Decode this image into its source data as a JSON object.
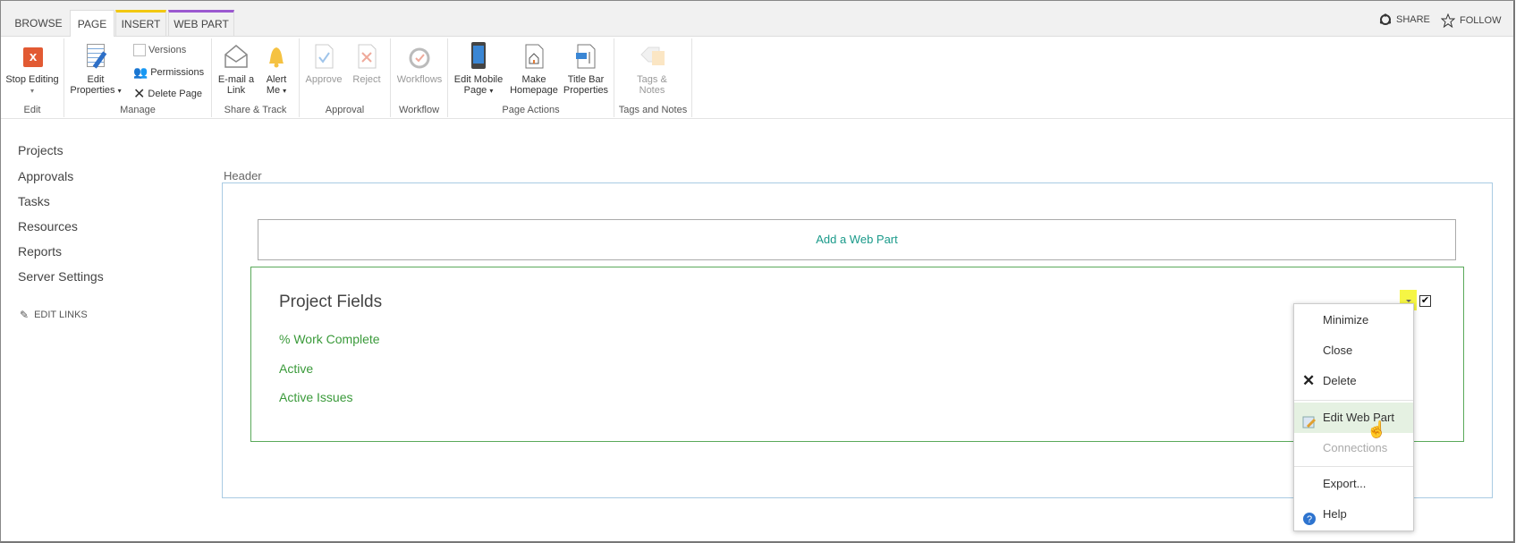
{
  "tabs": {
    "browse": "BROWSE",
    "page": "PAGE",
    "insert": "INSERT",
    "webpart": "WEB PART"
  },
  "top_actions": {
    "share": "SHARE",
    "follow": "FOLLOW"
  },
  "ribbon": {
    "edit": {
      "label": "Edit",
      "stop_editing": "Stop Editing"
    },
    "manage": {
      "label": "Manage",
      "edit_properties_1": "Edit",
      "edit_properties_2": "Properties",
      "versions": "Versions",
      "permissions": "Permissions",
      "delete_page": "Delete Page"
    },
    "share": {
      "label": "Share & Track",
      "email_1": "E-mail a",
      "email_2": "Link",
      "alert_1": "Alert",
      "alert_2": "Me"
    },
    "approval": {
      "label": "Approval",
      "approve": "Approve",
      "reject": "Reject"
    },
    "workflow": {
      "label": "Workflow",
      "workflows": "Workflows"
    },
    "page_actions": {
      "label": "Page Actions",
      "mobile_1": "Edit Mobile",
      "mobile_2": "Page",
      "home_1": "Make",
      "home_2": "Homepage",
      "title_1": "Title Bar",
      "title_2": "Properties"
    },
    "tags": {
      "label": "Tags and Notes",
      "tags_1": "Tags &",
      "tags_2": "Notes"
    }
  },
  "nav": [
    "Projects",
    "Approvals",
    "Tasks",
    "Resources",
    "Reports",
    "Server Settings"
  ],
  "edit_links": "EDIT LINKS",
  "zone_label": "Header",
  "add_web_part": "Add a Web Part",
  "webpart": {
    "title": "Project Fields",
    "links": [
      "% Work Complete",
      "Active",
      "Active Issues"
    ]
  },
  "menu": {
    "minimize": "Minimize",
    "close": "Close",
    "delete": "Delete",
    "edit": "Edit Web Part",
    "connections": "Connections",
    "export": "Export...",
    "help": "Help"
  }
}
